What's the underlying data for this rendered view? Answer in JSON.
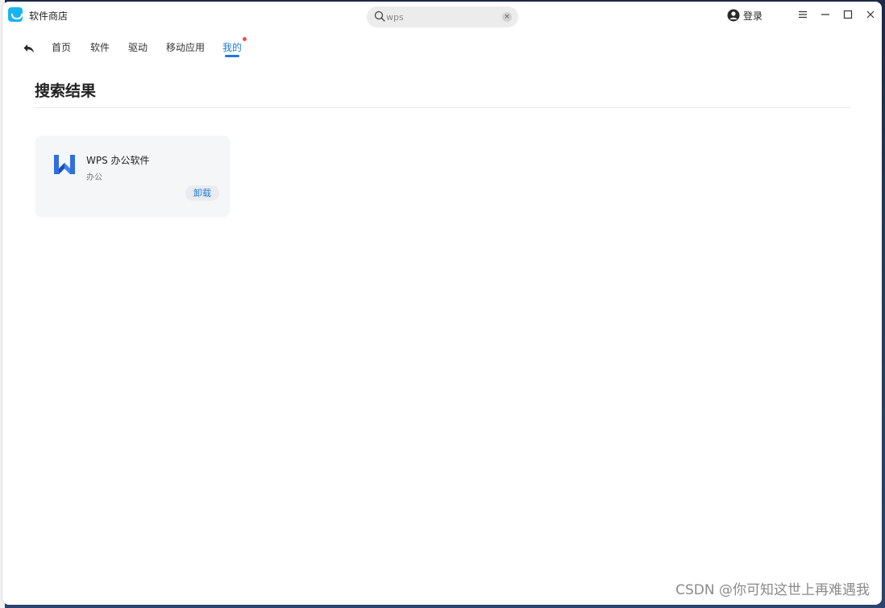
{
  "app": {
    "title": "软件商店",
    "logo_icon": "shopping-bag-icon",
    "accent_color": "#1f7ad9"
  },
  "search": {
    "value": "wps",
    "icon": "search-icon",
    "clear_icon": "close-icon"
  },
  "account": {
    "login_label": "登录",
    "icon": "user-icon"
  },
  "window_controls": [
    "menu-icon",
    "minimize-icon",
    "maximize-icon",
    "close-icon"
  ],
  "nav": {
    "back_icon": "back-arrow-icon",
    "tabs": [
      {
        "label": "首页"
      },
      {
        "label": "软件"
      },
      {
        "label": "驱动"
      },
      {
        "label": "移动应用"
      },
      {
        "label": "我的",
        "active": true,
        "notification_dot": true
      }
    ]
  },
  "main": {
    "title": "搜索结果",
    "results": [
      {
        "name": "WPS 办公软件",
        "category": "办公",
        "action_label": "卸载",
        "icon": "wps-icon"
      }
    ]
  },
  "watermark": "CSDN @你可知这世上再难遇我"
}
